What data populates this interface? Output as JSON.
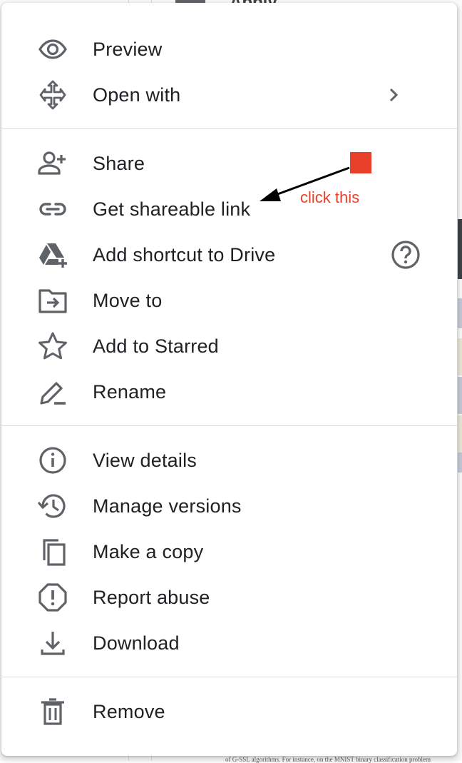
{
  "background": {
    "header_fragment": "Apply",
    "footnote_fragment": "of G-SSL algorithms. For instance, on the MNIST binary classification problem"
  },
  "menu": {
    "groups": [
      [
        {
          "label": "Preview",
          "icon": "eye-icon"
        },
        {
          "label": "Open with",
          "icon": "move-arrows-icon",
          "trailing": "chevron-right-icon"
        }
      ],
      [
        {
          "label": "Share",
          "icon": "person-add-icon"
        },
        {
          "label": "Get shareable link",
          "icon": "link-icon"
        },
        {
          "label": "Add shortcut to Drive",
          "icon": "drive-shortcut-icon",
          "trailing": "help-circle-icon"
        },
        {
          "label": "Move to",
          "icon": "folder-move-icon"
        },
        {
          "label": "Add to Starred",
          "icon": "star-outline-icon"
        },
        {
          "label": "Rename",
          "icon": "pencil-icon"
        }
      ],
      [
        {
          "label": "View details",
          "icon": "info-icon"
        },
        {
          "label": "Manage versions",
          "icon": "history-icon"
        },
        {
          "label": "Make a copy",
          "icon": "copy-icon"
        },
        {
          "label": "Report abuse",
          "icon": "report-octagon-icon"
        },
        {
          "label": "Download",
          "icon": "download-icon"
        }
      ],
      [
        {
          "label": "Remove",
          "icon": "trash-icon"
        }
      ]
    ]
  },
  "annotation": {
    "text": "click this",
    "color": "#e8402a"
  },
  "colors": {
    "icon": "#5f6368",
    "text": "#202124",
    "divider": "#dadce0"
  }
}
